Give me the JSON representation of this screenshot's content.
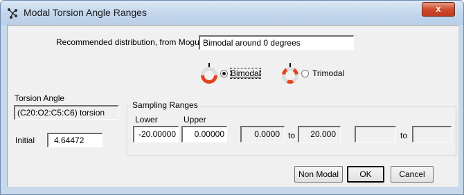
{
  "window": {
    "title": "Modal Torsion Angle Ranges",
    "close_label": "x",
    "close_icon": "close-icon",
    "title_icon": "molecule-icon"
  },
  "recommended": {
    "label": "Recommended distribution, from Mogul:",
    "value": "Bimodal around 0 degrees"
  },
  "modes": [
    {
      "label": "Bimodal",
      "selected": true,
      "icon": "lifebuoy-two-sections-icon"
    },
    {
      "label": "Trimodal",
      "selected": false,
      "icon": "lifebuoy-three-sections-icon"
    }
  ],
  "torsion": {
    "heading": "Torsion Angle",
    "atoms": "(C20:O2:C5:C6) torsion",
    "initial_label": "Initial",
    "initial_value": "4.64472"
  },
  "sampling": {
    "group_title": "Sampling Ranges",
    "lower_header": "Lower",
    "upper_header": "Upper",
    "ranges": [
      {
        "lower": "-20.00000",
        "upper": "0.00000",
        "editable": true
      },
      {
        "lower": "0.0000",
        "to_label": "to",
        "upper": "20.000",
        "editable": false
      },
      {
        "lower": "",
        "to_label": "to",
        "upper": "",
        "editable": false
      }
    ]
  },
  "buttons": {
    "non_modal": "Non Modal",
    "ok": "OK",
    "cancel": "Cancel"
  },
  "colors": {
    "titlebar": "#c2d5ec",
    "close": "#cf4b2f",
    "buoy_red": "#e0451f"
  }
}
